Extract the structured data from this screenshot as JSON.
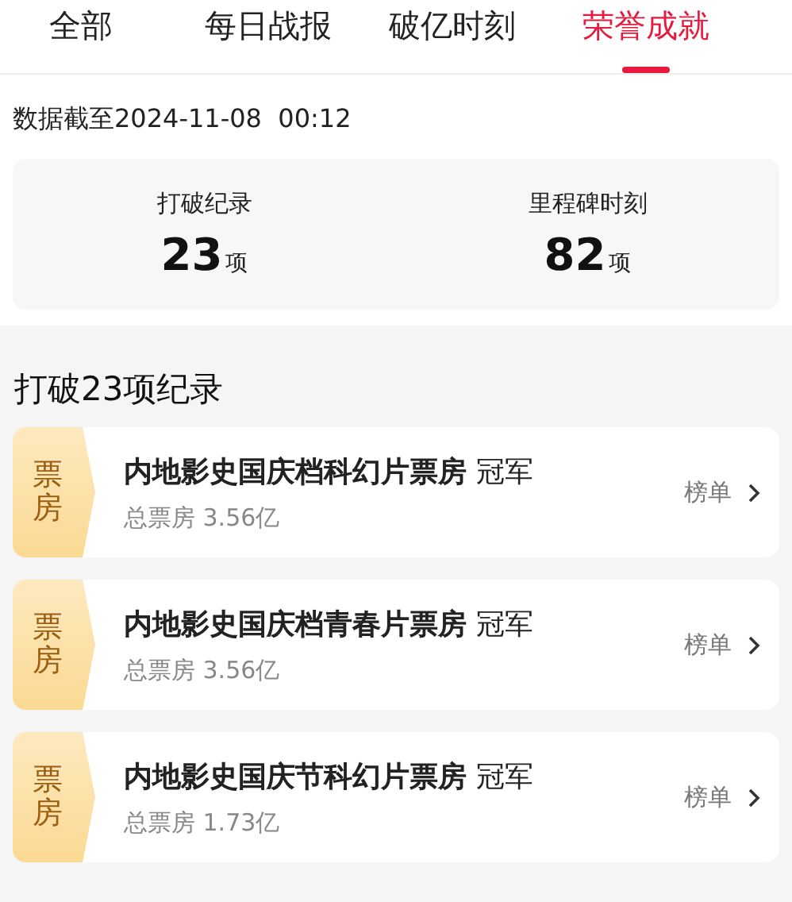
{
  "tabs": [
    {
      "label": "全部",
      "selected": false
    },
    {
      "label": "每日战报",
      "selected": false
    },
    {
      "label": "破亿时刻",
      "selected": false
    },
    {
      "label": "荣誉成就",
      "selected": true
    }
  ],
  "data_time": {
    "label": "数据截至",
    "value": "2024-11-08  00:12"
  },
  "stats": [
    {
      "label": "打破纪录",
      "value": "23",
      "unit": "项"
    },
    {
      "label": "里程碑时刻",
      "value": "82",
      "unit": "项"
    }
  ],
  "section_title": "打破23项纪录",
  "records": [
    {
      "badge": "票房",
      "title": "内地影史国庆档科幻片票房",
      "rank": "冠军",
      "subtitle": "总票房 3.56亿",
      "link": "榜单"
    },
    {
      "badge": "票房",
      "title": "内地影史国庆档青春片票房",
      "rank": "冠军",
      "subtitle": "总票房 3.56亿",
      "link": "榜单"
    },
    {
      "badge": "票房",
      "title": "内地影史国庆节科幻片票房",
      "rank": "冠军",
      "subtitle": "总票房 1.73亿",
      "link": "榜单"
    }
  ]
}
